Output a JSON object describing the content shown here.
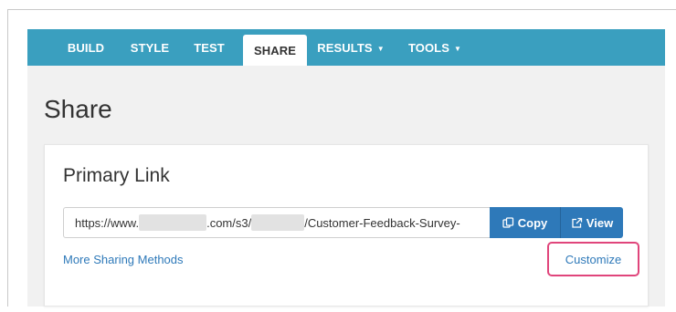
{
  "nav": {
    "items": [
      {
        "label": "BUILD"
      },
      {
        "label": "STYLE"
      },
      {
        "label": "TEST"
      },
      {
        "label": "SHARE",
        "active": true
      },
      {
        "label": "RESULTS",
        "dropdown": true
      },
      {
        "label": "TOOLS",
        "dropdown": true
      }
    ],
    "caret": "▼"
  },
  "page": {
    "title": "Share"
  },
  "primary_link": {
    "title": "Primary Link",
    "url_prefix": "https://www.",
    "url_middle": ".com/s3/",
    "url_suffix": "/Customer-Feedback-Survey-",
    "copy_label": "Copy",
    "view_label": "View",
    "more_label": "More Sharing Methods",
    "customize_label": "Customize"
  },
  "colors": {
    "navbar": "#3a9fbf",
    "button": "#2e79b9",
    "link": "#2e79b9",
    "highlight": "#e0457b"
  },
  "icons": {
    "copy": "copy-icon",
    "view": "external-link-icon"
  }
}
